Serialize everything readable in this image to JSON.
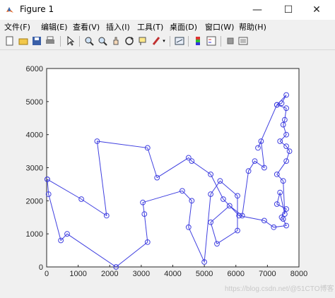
{
  "window": {
    "title": "Figure 1",
    "minimize": "—",
    "maximize": "☐",
    "close": "✕"
  },
  "menu": [
    {
      "label": "文件(F)"
    },
    {
      "label": "编辑(E)"
    },
    {
      "label": "查看(V)"
    },
    {
      "label": "插入(I)"
    },
    {
      "label": "工具(T)"
    },
    {
      "label": "桌面(D)"
    },
    {
      "label": "窗口(W)"
    },
    {
      "label": "帮助(H)"
    }
  ],
  "toolbar": {
    "icons": [
      "new-figure-icon",
      "open-file-icon",
      "save-icon",
      "print-icon",
      "pointer-icon",
      "zoom-in-icon",
      "zoom-out-icon",
      "pan-icon",
      "rotate-icon",
      "data-cursor-icon",
      "brush-icon",
      "link-icon",
      "colorbar-icon",
      "legend-icon",
      "hide-plot-tools-icon",
      "show-plot-tools-icon"
    ]
  },
  "watermark": "https://blog.csdn.net/@51CTO博客",
  "chart_data": {
    "type": "line",
    "marker": "circle",
    "line_color": "#4040e0",
    "xlim": [
      0,
      8000
    ],
    "ylim": [
      0,
      6000
    ],
    "xticks": [
      "0",
      "1000",
      "2000",
      "3000",
      "4000",
      "5000",
      "6000",
      "7000",
      "8000"
    ],
    "yticks": [
      "0",
      "1000",
      "2000",
      "3000",
      "4000",
      "5000",
      "6000"
    ],
    "x": [
      20,
      60,
      450,
      650,
      2200,
      3200,
      3100,
      3050,
      4300,
      4600,
      4500,
      5000,
      5200,
      5500,
      6050,
      6050,
      5400,
      5200,
      5800,
      6200,
      6400,
      6600,
      6900,
      6800,
      6700,
      7300,
      7450,
      7600,
      7300,
      7600,
      7550,
      7500,
      7600,
      7400,
      7600,
      7700,
      7600,
      7300,
      7500,
      7550,
      7400,
      7300,
      7600,
      7450,
      7500,
      7600,
      7200,
      6900,
      6100,
      5600,
      5200,
      4600,
      4500,
      3500,
      3200,
      1600,
      1900,
      1100,
      20
    ],
    "y": [
      2650,
      2200,
      800,
      1000,
      0,
      750,
      1600,
      1950,
      2300,
      2000,
      1200,
      150,
      2200,
      2600,
      2150,
      1100,
      700,
      1350,
      1850,
      1550,
      2900,
      3200,
      3000,
      3800,
      3600,
      4900,
      4950,
      5200,
      4900,
      4800,
      4450,
      4300,
      4000,
      3800,
      3650,
      3500,
      3200,
      2800,
      2600,
      1600,
      2250,
      1900,
      1750,
      1500,
      1450,
      1250,
      1200,
      1400,
      1550,
      2050,
      2800,
      3200,
      3300,
      2700,
      3600,
      3800,
      1550,
      2050,
      2650
    ]
  }
}
